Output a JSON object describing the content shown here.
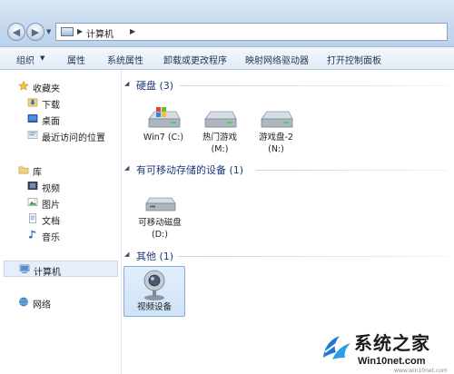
{
  "address_bar": {
    "path_label": "计算机"
  },
  "toolbar": {
    "organize": "组织",
    "properties": "属性",
    "system_properties": "系统属性",
    "uninstall": "卸载或更改程序",
    "map_drive": "映射网络驱动器",
    "control_panel": "打开控制面板"
  },
  "sidebar": {
    "favorites": "收藏夹",
    "downloads": "下载",
    "desktop": "桌面",
    "recent": "最近访问的位置",
    "libraries": "库",
    "videos": "视频",
    "pictures": "图片",
    "documents": "文档",
    "music": "音乐",
    "computer": "计算机",
    "network": "网络"
  },
  "groups": {
    "hard_disks": {
      "title": "硬盘 (3)",
      "items": [
        {
          "name": "Win7",
          "letter": "(C:)"
        },
        {
          "name": "热门游戏",
          "letter": "(M:)"
        },
        {
          "name": "游戏盘-2",
          "letter": "(N:)"
        }
      ]
    },
    "removable": {
      "title": "有可移动存储的设备 (1)",
      "items": [
        {
          "name": "可移动磁盘",
          "letter": "(D:)"
        }
      ]
    },
    "other": {
      "title": "其他 (1)",
      "items": [
        {
          "name": "视频设备"
        }
      ]
    }
  },
  "watermark": {
    "title": "系统之家",
    "site": "Win10net.com",
    "url": "www.win10net.com"
  },
  "colors": {
    "group_title": "#1e3a7a",
    "selection_bg": "#cfe2f8",
    "selection_border": "#84acdd",
    "toolbar_bg": "#e2ebf6"
  }
}
